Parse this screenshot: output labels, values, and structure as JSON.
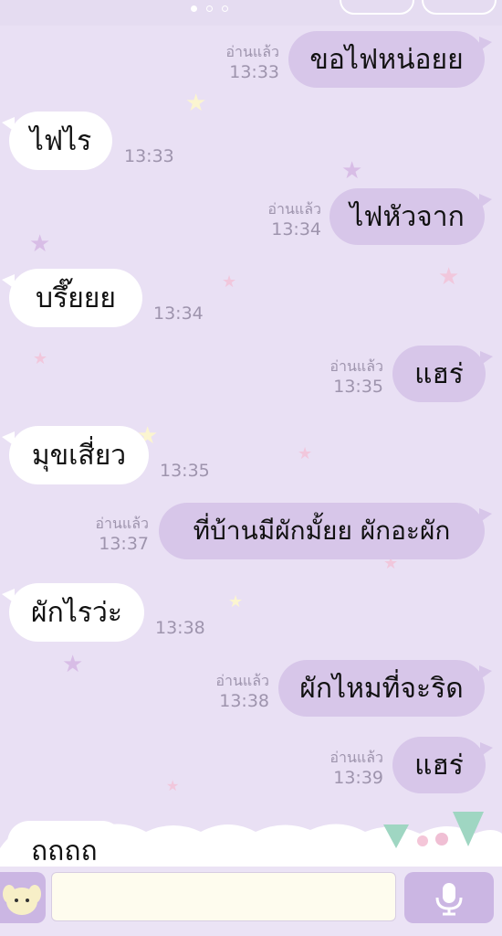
{
  "colors": {
    "background": "#e9e0f4",
    "outgoing_bubble": "#d7c6e9",
    "incoming_bubble": "#ffffff",
    "meta_text": "#9e94ad",
    "input_bg": "#fefcee"
  },
  "page_indicator": {
    "count": 3,
    "active": 1
  },
  "messages": [
    {
      "dir": "out",
      "text": "ขอไฟหน่อยย",
      "read": "อ่านแล้ว",
      "time": "13:33"
    },
    {
      "dir": "in",
      "text": "ไฟไร",
      "time": "13:33"
    },
    {
      "dir": "out",
      "text": "ไฟหัวจาก",
      "read": "อ่านแล้ว",
      "time": "13:34"
    },
    {
      "dir": "in",
      "text": "บรึ๊ยยย",
      "time": "13:34"
    },
    {
      "dir": "out",
      "text": "แฮร่",
      "read": "อ่านแล้ว",
      "time": "13:35"
    },
    {
      "dir": "in",
      "text": "มุขเสี่ยว",
      "time": "13:35"
    },
    {
      "dir": "out",
      "text": "ที่บ้านมีผักมั้ยย ผักอะผัก",
      "read": "อ่านแล้ว",
      "time": "13:37"
    },
    {
      "dir": "in",
      "text": "ผักไรว่ะ",
      "time": "13:38"
    },
    {
      "dir": "out",
      "text": "ผักไหมที่จะริด",
      "read": "อ่านแล้ว",
      "time": "13:38"
    },
    {
      "dir": "out",
      "text": "แฮร่",
      "read": "อ่านแล้ว",
      "time": "13:39"
    },
    {
      "dir": "in",
      "text": "ถถถถ",
      "time": ""
    }
  ],
  "icons": {
    "sticker": "bunny-sticker-icon",
    "mic": "microphone-icon"
  },
  "input": {
    "value": "",
    "placeholder": ""
  }
}
